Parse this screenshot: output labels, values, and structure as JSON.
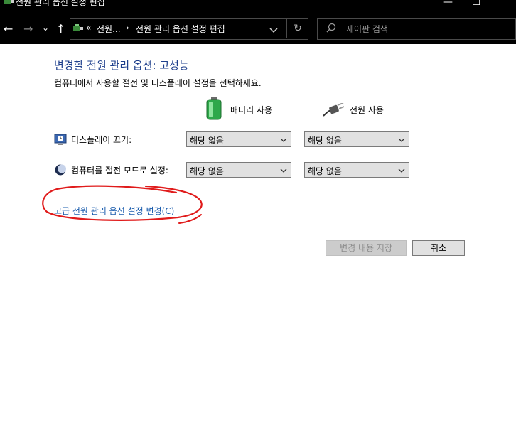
{
  "window": {
    "title": "전원 관리 옵션 설정 편집",
    "minimize_glyph": "—",
    "maximize_glyph": "☐"
  },
  "nav": {
    "back_glyph": "←",
    "forward_glyph": "→",
    "recent_glyph": "⌄",
    "up_glyph": "↑",
    "breadcrumb_overflow": "«",
    "breadcrumb_parent": "전원...",
    "breadcrumb_sep": "›",
    "breadcrumb_current": "전원 관리 옵션 설정 편집",
    "refresh_glyph": "↻",
    "search_placeholder": "제어판 검색"
  },
  "content": {
    "heading": "변경할 전원 관리 옵션: 고성능",
    "description": "컴퓨터에서 사용할 절전 및 디스플레이 설정을 선택하세요.",
    "columns": {
      "battery": "배터리 사용",
      "plugged": "전원 사용"
    },
    "rows": [
      {
        "label": "디스플레이 끄기:",
        "battery_value": "해당 없음",
        "plugged_value": "해당 없음"
      },
      {
        "label": "컴퓨터를 절전 모드로 설정:",
        "battery_value": "해당 없음",
        "plugged_value": "해당 없음"
      }
    ],
    "advanced_link": "고급 전원 관리 옵션 설정 변경(C)"
  },
  "footer": {
    "save_label": "변경 내용 저장",
    "cancel_label": "취소"
  },
  "colors": {
    "heading": "#1e3f8c",
    "link": "#1a5cad",
    "annotation": "#e01b1b"
  },
  "icons": [
    "power-options-icon",
    "search-icon",
    "battery-icon",
    "power-plug-icon",
    "monitor-clock-icon",
    "sleep-moon-icon"
  ]
}
